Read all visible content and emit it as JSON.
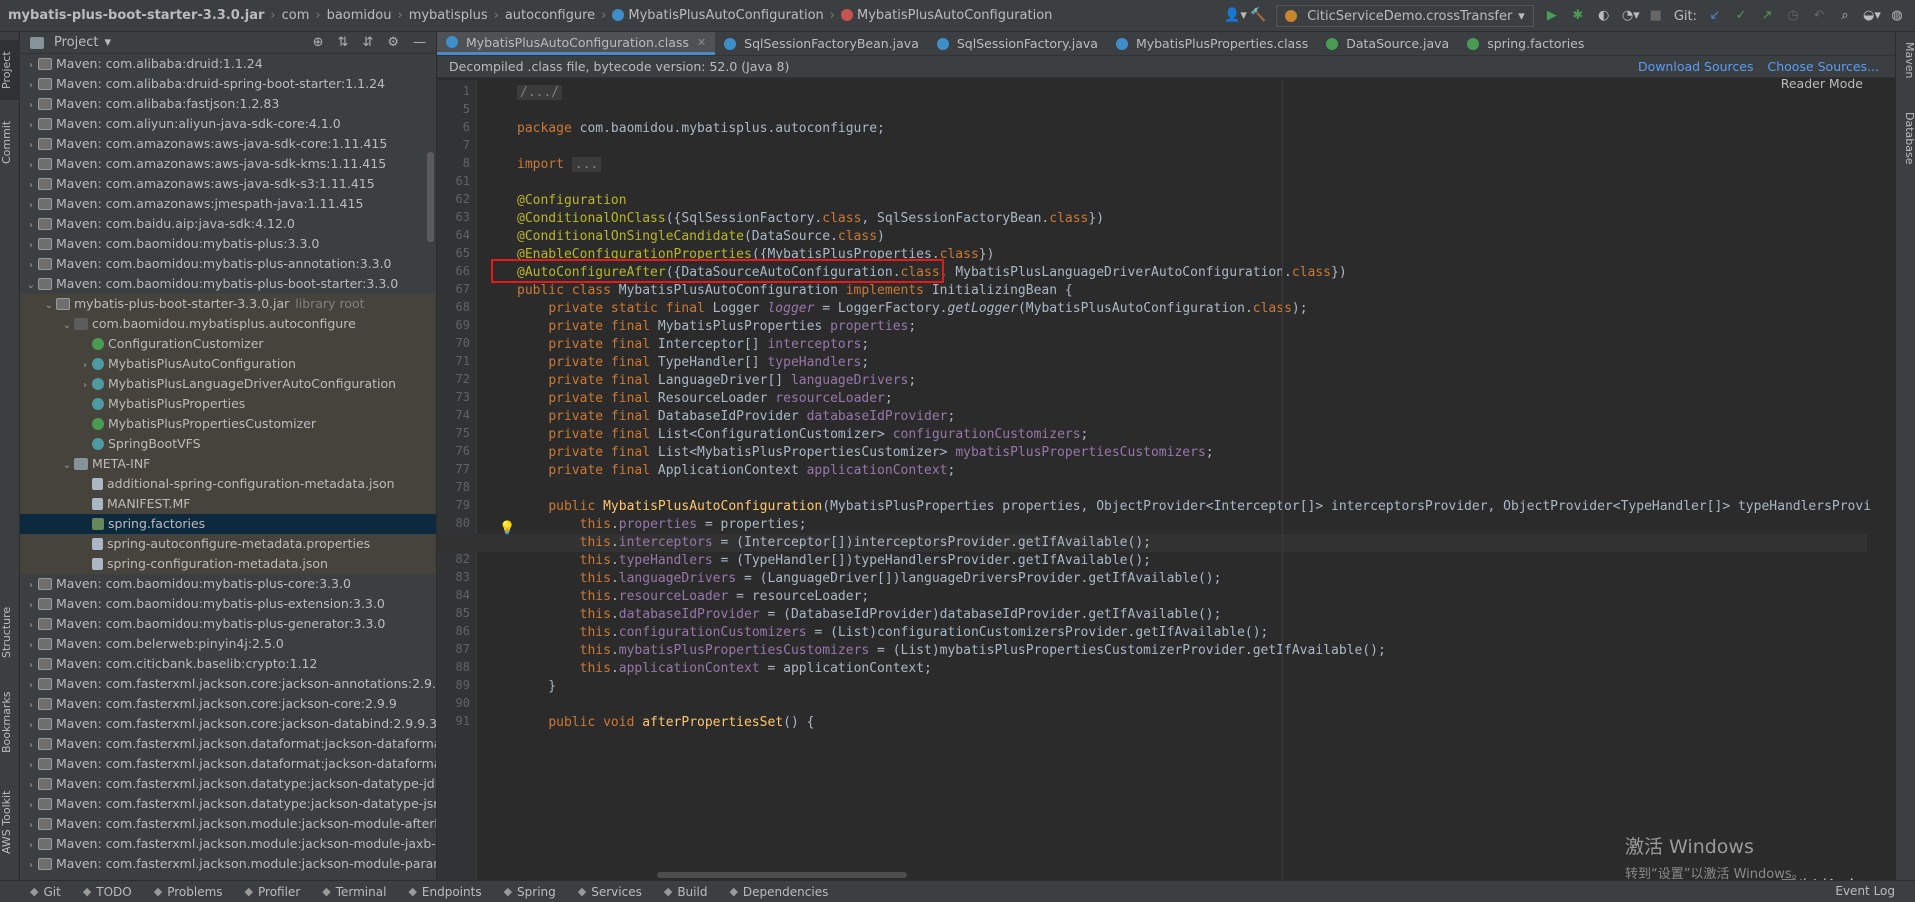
{
  "breadcrumbs": [
    "mybatis-plus-boot-starter-3.3.0.jar",
    "com",
    "baomidou",
    "mybatisplus",
    "autoconfigure",
    "MybatisPlusAutoConfiguration",
    "MybatisPlusAutoConfiguration"
  ],
  "run_config": "CiticServiceDemo.crossTransfer",
  "git_label": "Git:",
  "project_title": "Project",
  "tree": [
    {
      "d": 1,
      "arrow": "›",
      "icon": "jar",
      "label": "Maven: com.alibaba:druid:1.1.24",
      "kind": "normal"
    },
    {
      "d": 1,
      "arrow": "›",
      "icon": "jar",
      "label": "Maven: com.alibaba:druid-spring-boot-starter:1.1.24",
      "kind": "normal"
    },
    {
      "d": 1,
      "arrow": "›",
      "icon": "jar",
      "label": "Maven: com.alibaba:fastjson:1.2.83",
      "kind": "normal"
    },
    {
      "d": 1,
      "arrow": "›",
      "icon": "jar",
      "label": "Maven: com.aliyun:aliyun-java-sdk-core:4.1.0",
      "kind": "normal"
    },
    {
      "d": 1,
      "arrow": "›",
      "icon": "jar",
      "label": "Maven: com.amazonaws:aws-java-sdk-core:1.11.415",
      "kind": "normal"
    },
    {
      "d": 1,
      "arrow": "›",
      "icon": "jar",
      "label": "Maven: com.amazonaws:aws-java-sdk-kms:1.11.415",
      "kind": "normal"
    },
    {
      "d": 1,
      "arrow": "›",
      "icon": "jar",
      "label": "Maven: com.amazonaws:aws-java-sdk-s3:1.11.415",
      "kind": "normal"
    },
    {
      "d": 1,
      "arrow": "›",
      "icon": "jar",
      "label": "Maven: com.amazonaws:jmespath-java:1.11.415",
      "kind": "normal"
    },
    {
      "d": 1,
      "arrow": "›",
      "icon": "jar",
      "label": "Maven: com.baidu.aip:java-sdk:4.12.0",
      "kind": "normal"
    },
    {
      "d": 1,
      "arrow": "›",
      "icon": "jar",
      "label": "Maven: com.baomidou:mybatis-plus:3.3.0",
      "kind": "normal"
    },
    {
      "d": 1,
      "arrow": "›",
      "icon": "jar",
      "label": "Maven: com.baomidou:mybatis-plus-annotation:3.3.0",
      "kind": "normal"
    },
    {
      "d": 1,
      "arrow": "⌄",
      "icon": "jar",
      "label": "Maven: com.baomidou:mybatis-plus-boot-starter:3.3.0",
      "kind": "normal"
    },
    {
      "d": 2,
      "arrow": "⌄",
      "icon": "jar",
      "label": "mybatis-plus-boot-starter-3.3.0.jar",
      "suffix": "library root",
      "kind": "lib"
    },
    {
      "d": 3,
      "arrow": "⌄",
      "icon": "pkg",
      "label": "com.baomidou.mybatisplus.autoconfigure",
      "kind": "lib"
    },
    {
      "d": 4,
      "arrow": "",
      "icon": "cls",
      "label": "ConfigurationCustomizer",
      "kind": "lib"
    },
    {
      "d": 4,
      "arrow": "›",
      "icon": "cfg",
      "label": "MybatisPlusAutoConfiguration",
      "kind": "lib"
    },
    {
      "d": 4,
      "arrow": "›",
      "icon": "cfg",
      "label": "MybatisPlusLanguageDriverAutoConfiguration",
      "kind": "lib"
    },
    {
      "d": 4,
      "arrow": "",
      "icon": "cfg",
      "label": "MybatisPlusProperties",
      "kind": "lib"
    },
    {
      "d": 4,
      "arrow": "",
      "icon": "cls",
      "label": "MybatisPlusPropertiesCustomizer",
      "kind": "lib"
    },
    {
      "d": 4,
      "arrow": "",
      "icon": "cfg",
      "label": "SpringBootVFS",
      "kind": "lib"
    },
    {
      "d": 3,
      "arrow": "⌄",
      "icon": "fld",
      "label": "META-INF",
      "kind": "lib"
    },
    {
      "d": 4,
      "arrow": "",
      "icon": "file",
      "label": "additional-spring-configuration-metadata.json",
      "kind": "lib"
    },
    {
      "d": 4,
      "arrow": "",
      "icon": "file",
      "label": "MANIFEST.MF",
      "kind": "lib"
    },
    {
      "d": 4,
      "arrow": "",
      "icon": "leaf",
      "label": "spring.factories",
      "kind": "sel"
    },
    {
      "d": 4,
      "arrow": "",
      "icon": "file",
      "label": "spring-autoconfigure-metadata.properties",
      "kind": "lib"
    },
    {
      "d": 4,
      "arrow": "",
      "icon": "file",
      "label": "spring-configuration-metadata.json",
      "kind": "lib"
    },
    {
      "d": 1,
      "arrow": "›",
      "icon": "jar",
      "label": "Maven: com.baomidou:mybatis-plus-core:3.3.0",
      "kind": "normal"
    },
    {
      "d": 1,
      "arrow": "›",
      "icon": "jar",
      "label": "Maven: com.baomidou:mybatis-plus-extension:3.3.0",
      "kind": "normal"
    },
    {
      "d": 1,
      "arrow": "›",
      "icon": "jar",
      "label": "Maven: com.baomidou:mybatis-plus-generator:3.3.0",
      "kind": "normal"
    },
    {
      "d": 1,
      "arrow": "›",
      "icon": "jar",
      "label": "Maven: com.belerweb:pinyin4j:2.5.0",
      "kind": "normal"
    },
    {
      "d": 1,
      "arrow": "›",
      "icon": "jar",
      "label": "Maven: com.citicbank.baselib:crypto:1.12",
      "kind": "normal"
    },
    {
      "d": 1,
      "arrow": "›",
      "icon": "jar",
      "label": "Maven: com.fasterxml.jackson.core:jackson-annotations:2.9.0",
      "kind": "normal"
    },
    {
      "d": 1,
      "arrow": "›",
      "icon": "jar",
      "label": "Maven: com.fasterxml.jackson.core:jackson-core:2.9.9",
      "kind": "normal"
    },
    {
      "d": 1,
      "arrow": "›",
      "icon": "jar",
      "label": "Maven: com.fasterxml.jackson.core:jackson-databind:2.9.9.3",
      "kind": "normal"
    },
    {
      "d": 1,
      "arrow": "›",
      "icon": "jar",
      "label": "Maven: com.fasterxml.jackson.dataformat:jackson-dataformat",
      "kind": "normal"
    },
    {
      "d": 1,
      "arrow": "›",
      "icon": "jar",
      "label": "Maven: com.fasterxml.jackson.dataformat:jackson-dataformat",
      "kind": "normal"
    },
    {
      "d": 1,
      "arrow": "›",
      "icon": "jar",
      "label": "Maven: com.fasterxml.jackson.datatype:jackson-datatype-jdk8",
      "kind": "normal"
    },
    {
      "d": 1,
      "arrow": "›",
      "icon": "jar",
      "label": "Maven: com.fasterxml.jackson.datatype:jackson-datatype-jsr3",
      "kind": "normal"
    },
    {
      "d": 1,
      "arrow": "›",
      "icon": "jar",
      "label": "Maven: com.fasterxml.jackson.module:jackson-module-afterb",
      "kind": "normal"
    },
    {
      "d": 1,
      "arrow": "›",
      "icon": "jar",
      "label": "Maven: com.fasterxml.jackson.module:jackson-module-jaxb-a",
      "kind": "normal"
    },
    {
      "d": 1,
      "arrow": "›",
      "icon": "jar",
      "label": "Maven: com.fasterxml.jackson.module:jackson-module-param",
      "kind": "normal"
    }
  ],
  "tabs": [
    {
      "label": "MybatisPlusAutoConfiguration.class",
      "active": true,
      "color": "blue"
    },
    {
      "label": "SqlSessionFactoryBean.java",
      "active": false,
      "color": "blue"
    },
    {
      "label": "SqlSessionFactory.java",
      "active": false,
      "color": "blue"
    },
    {
      "label": "MybatisPlusProperties.class",
      "active": false,
      "color": "blue"
    },
    {
      "label": "DataSource.java",
      "active": false,
      "color": "green"
    },
    {
      "label": "spring.factories",
      "active": false,
      "color": "green"
    }
  ],
  "infobar": {
    "text": "Decompiled .class file, bytecode version: 52.0 (Java 8)",
    "download_sources": "Download Sources",
    "choose_sources": "Choose Sources..."
  },
  "reader_mode": "Reader Mode",
  "code_lines": [
    {
      "n": "1",
      "html": "<span class=\"fold\">/.../</span>"
    },
    {
      "n": "5",
      "html": ""
    },
    {
      "n": "6",
      "html": "<span class=\"k\">package</span> com.baomidou.mybatisplus.autoconfigure;"
    },
    {
      "n": "7",
      "html": ""
    },
    {
      "n": "8",
      "html": "<span class=\"k\">import</span> <span class=\"fold\">...</span>"
    },
    {
      "n": "61",
      "html": ""
    },
    {
      "n": "62",
      "html": "<span class=\"a\">@Configuration</span>"
    },
    {
      "n": "63",
      "html": "<span class=\"a\">@ConditionalOnClass</span>({SqlSessionFactory.<span class=\"k\">class</span>, SqlSessionFactoryBean.<span class=\"k\">class</span>})"
    },
    {
      "n": "64",
      "html": "<span class=\"a\">@ConditionalOnSingleCandidate</span>(DataSource.<span class=\"k\">class</span>)"
    },
    {
      "n": "65",
      "html": "<span class=\"a\">@EnableConfigurationProperties</span>({MybatisPlusProperties.<span class=\"k\">class</span>})"
    },
    {
      "n": "66",
      "html": "<span class=\"a\">@AutoConfigureAfter</span>({DataSourceAutoConfiguration.<span class=\"k\">class</span>, MybatisPlusLanguageDriverAutoConfiguration.<span class=\"k\">class</span>})"
    },
    {
      "n": "67",
      "html": "<span class=\"k\">public class</span> MybatisPlusAutoConfiguration <span class=\"k\">implements</span> InitializingBean {"
    },
    {
      "n": "68",
      "html": "    <span class=\"k\">private static final</span> Logger <span class=\"f it\">logger</span> = LoggerFactory.<span class=\"it\">getLogger</span>(MybatisPlusAutoConfiguration.<span class=\"k\">class</span>);"
    },
    {
      "n": "69",
      "html": "    <span class=\"k\">private final</span> MybatisPlusProperties <span class=\"f\">properties</span>;"
    },
    {
      "n": "70",
      "html": "    <span class=\"k\">private final</span> Interceptor[] <span class=\"f\">interceptors</span>;"
    },
    {
      "n": "71",
      "html": "    <span class=\"k\">private final</span> TypeHandler[] <span class=\"f\">typeHandlers</span>;"
    },
    {
      "n": "72",
      "html": "    <span class=\"k\">private final</span> LanguageDriver[] <span class=\"f\">languageDrivers</span>;"
    },
    {
      "n": "73",
      "html": "    <span class=\"k\">private final</span> ResourceLoader <span class=\"f\">resourceLoader</span>;"
    },
    {
      "n": "74",
      "html": "    <span class=\"k\">private final</span> DatabaseIdProvider <span class=\"f\">databaseIdProvider</span>;"
    },
    {
      "n": "75",
      "html": "    <span class=\"k\">private final</span> List&lt;ConfigurationCustomizer&gt; <span class=\"f\">configurationCustomizers</span>;"
    },
    {
      "n": "76",
      "html": "    <span class=\"k\">private final</span> List&lt;MybatisPlusPropertiesCustomizer&gt; <span class=\"f\">mybatisPlusPropertiesCustomizers</span>;"
    },
    {
      "n": "77",
      "html": "    <span class=\"k\">private final</span> ApplicationContext <span class=\"f\">applicationContext</span>;"
    },
    {
      "n": "78",
      "html": ""
    },
    {
      "n": "79",
      "html": "    <span class=\"k\">public</span> <span class=\"m\">MybatisPlusAutoConfiguration</span>(MybatisPlusProperties properties, ObjectProvider&lt;Interceptor[]&gt; interceptorsProvider, ObjectProvider&lt;TypeHandler[]&gt; typeHandlersProvi"
    },
    {
      "n": "80",
      "html": "        <span class=\"k\">this</span>.<span class=\"f\">properties</span> = properties;"
    },
    {
      "n": "81",
      "html": "        <span class=\"k\">this</span>.<span class=\"f\">interceptors</span> = (Interceptor[])interceptorsProvider.getIfAvailable();",
      "cur": true
    },
    {
      "n": "82",
      "html": "        <span class=\"k\">this</span>.<span class=\"f\">typeHandlers</span> = (TypeHandler[])typeHandlersProvider.getIfAvailable();"
    },
    {
      "n": "83",
      "html": "        <span class=\"k\">this</span>.<span class=\"f\">languageDrivers</span> = (LanguageDriver[])languageDriversProvider.getIfAvailable();"
    },
    {
      "n": "84",
      "html": "        <span class=\"k\">this</span>.<span class=\"f\">resourceLoader</span> = resourceLoader;"
    },
    {
      "n": "85",
      "html": "        <span class=\"k\">this</span>.<span class=\"f\">databaseIdProvider</span> = (DatabaseIdProvider)databaseIdProvider.getIfAvailable();"
    },
    {
      "n": "86",
      "html": "        <span class=\"k\">this</span>.<span class=\"f\">configurationCustomizers</span> = (List)configurationCustomizersProvider.getIfAvailable();"
    },
    {
      "n": "87",
      "html": "        <span class=\"k\">this</span>.<span class=\"f\">mybatisPlusPropertiesCustomizers</span> = (List)mybatisPlusPropertiesCustomizerProvider.getIfAvailable();"
    },
    {
      "n": "88",
      "html": "        <span class=\"k\">this</span>.<span class=\"f\">applicationContext</span> = applicationContext;"
    },
    {
      "n": "89",
      "html": "    }"
    },
    {
      "n": "90",
      "html": ""
    },
    {
      "n": "91",
      "html": "    <span class=\"k\">public void</span> <span class=\"m\">afterPropertiesSet</span>() {"
    }
  ],
  "left_tabs": [
    "Project",
    "Commit",
    "Structure",
    "Bookmarks",
    "AWS Toolkit"
  ],
  "right_tabs": [
    "Maven",
    "Database"
  ],
  "bottom_tabs": [
    {
      "icon": "git-icon",
      "label": "Git"
    },
    {
      "icon": "todo-icon",
      "label": "TODO"
    },
    {
      "icon": "problems-icon",
      "label": "Problems"
    },
    {
      "icon": "profiler-icon",
      "label": "Profiler"
    },
    {
      "icon": "terminal-icon",
      "label": "Terminal"
    },
    {
      "icon": "endpoints-icon",
      "label": "Endpoints"
    },
    {
      "icon": "spring-icon",
      "label": "Spring"
    },
    {
      "icon": "services-icon",
      "label": "Services"
    },
    {
      "icon": "build-icon",
      "label": "Build"
    },
    {
      "icon": "dependencies-icon",
      "label": "Dependencies"
    }
  ],
  "event_log": "Event Log",
  "watermark": {
    "line1": "激活 Windows",
    "line2": "转到“设置”以激活 Windows。"
  },
  "csdn": "CSDN @不肯过江东丶"
}
